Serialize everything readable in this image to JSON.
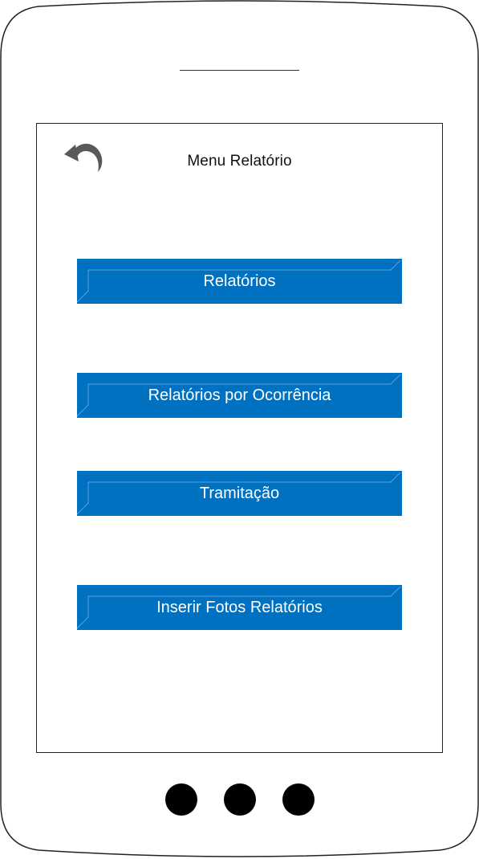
{
  "screen": {
    "title": "Menu Relatório",
    "back_icon": "undo-arrow-icon"
  },
  "menu": {
    "items": [
      {
        "label": "Relatórios"
      },
      {
        "label": "Relatórios por Ocorrência"
      },
      {
        "label": "Tramitação"
      },
      {
        "label": "Inserir Fotos Relatórios"
      }
    ]
  },
  "device": {
    "hardware_buttons": 3
  },
  "colors": {
    "button_bg": "#0070c0",
    "button_text": "#ffffff",
    "frame_stroke": "#222222"
  }
}
